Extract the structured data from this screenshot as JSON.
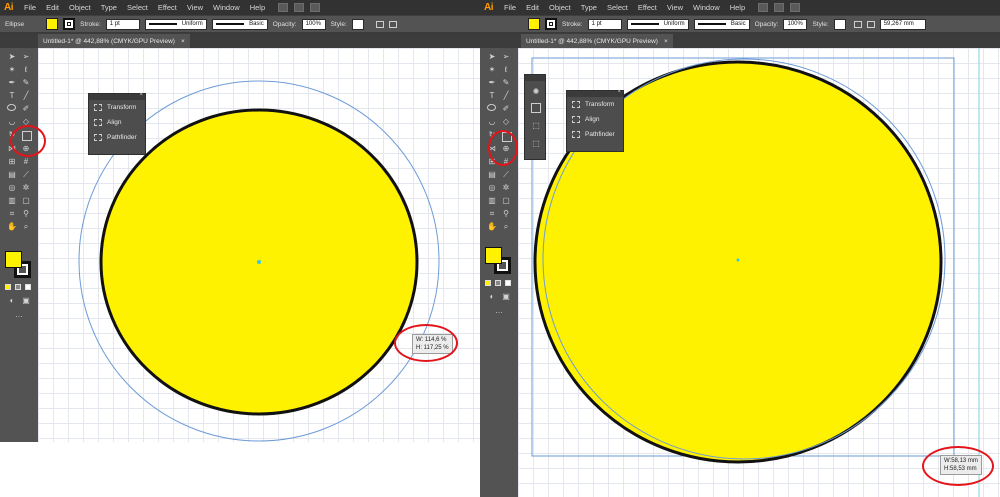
{
  "menubar": {
    "app_logo": "Ai",
    "items": [
      "File",
      "Edit",
      "Object",
      "Type",
      "Select",
      "Effect",
      "View",
      "Window",
      "Help"
    ]
  },
  "control_bar": {
    "tool_name": "Ellipse",
    "stroke_label": "Stroke:",
    "stroke_weight": "1 pt",
    "profile_uniform": "Uniform",
    "brush_basic": "Basic",
    "opacity_label": "Opacity:",
    "opacity_value": "100%",
    "style_label": "Style:",
    "right_width_value": "59,267 mm"
  },
  "document": {
    "tab_title": "Untitled-1* @ 442,88% (CMYK/GPU Preview)",
    "close_glyph": "×"
  },
  "panel": {
    "items": [
      "Transform",
      "Align",
      "Pathfinder"
    ]
  },
  "readouts": {
    "left_w": "W: 114,6 %",
    "left_h": "H: 117,25 %",
    "right_w": "W:58,13 mm",
    "right_h": "H:58,53 mm"
  },
  "colors": {
    "fill": "#fff200",
    "stroke": "#111111",
    "bounding_box": "#6e9bd6",
    "highlight": "#e3141a"
  }
}
